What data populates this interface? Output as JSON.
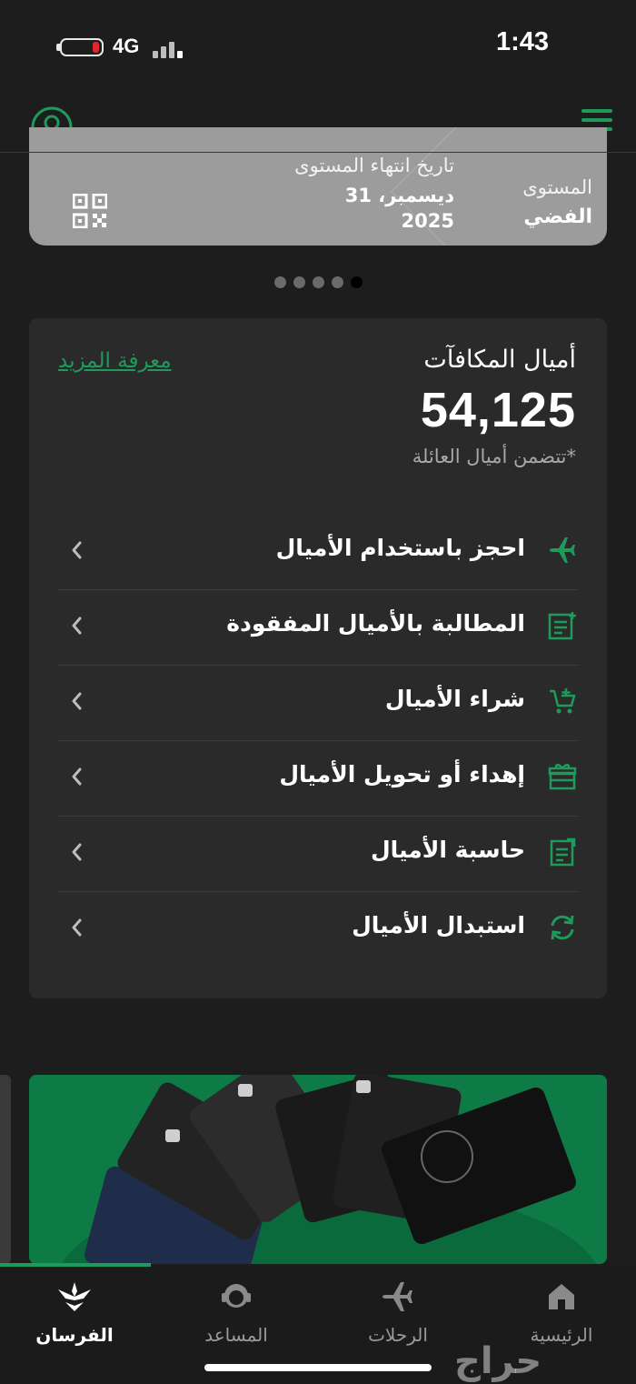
{
  "status_bar": {
    "time": "1:43",
    "network": "4G"
  },
  "tier_card": {
    "level_label": "المستوى",
    "level_value": "الفضي",
    "expiry_label": "تاريخ انتهاء المستوى",
    "expiry_value": "31 ديسمبر، 2025"
  },
  "carousel": {
    "count": 5,
    "active_index": 4
  },
  "miles": {
    "title": "أميال المكافآت",
    "learn_more": "معرفة المزيد",
    "value": "54,125",
    "note": "تتضمن أميال العائلة*"
  },
  "menu": [
    {
      "label": "احجز باستخدام الأميال",
      "icon": "airplane-icon"
    },
    {
      "label": "المطالبة بالأميال المفقودة",
      "icon": "claim-document-icon"
    },
    {
      "label": "شراء الأميال",
      "icon": "cart-plus-icon"
    },
    {
      "label": "إهداء أو تحويل الأميال",
      "icon": "gift-icon"
    },
    {
      "label": "حاسبة الأميال",
      "icon": "calculator-icon"
    },
    {
      "label": "استبدال الأميال",
      "icon": "exchange-icon"
    }
  ],
  "bottom_nav": [
    {
      "label": "الرئيسية",
      "icon": "home-icon",
      "active": false
    },
    {
      "label": "الرحلات",
      "icon": "airplane-icon",
      "active": false
    },
    {
      "label": "المساعد",
      "icon": "assistant-icon",
      "active": false
    },
    {
      "label": "الفرسان",
      "icon": "alfursan-logo-icon",
      "active": true
    }
  ],
  "watermark": "حراج",
  "colors": {
    "accent": "#1e9b5a",
    "background": "#1d1d1d",
    "panel": "#2a2a2a",
    "tier_card": "#9c9c9c"
  }
}
